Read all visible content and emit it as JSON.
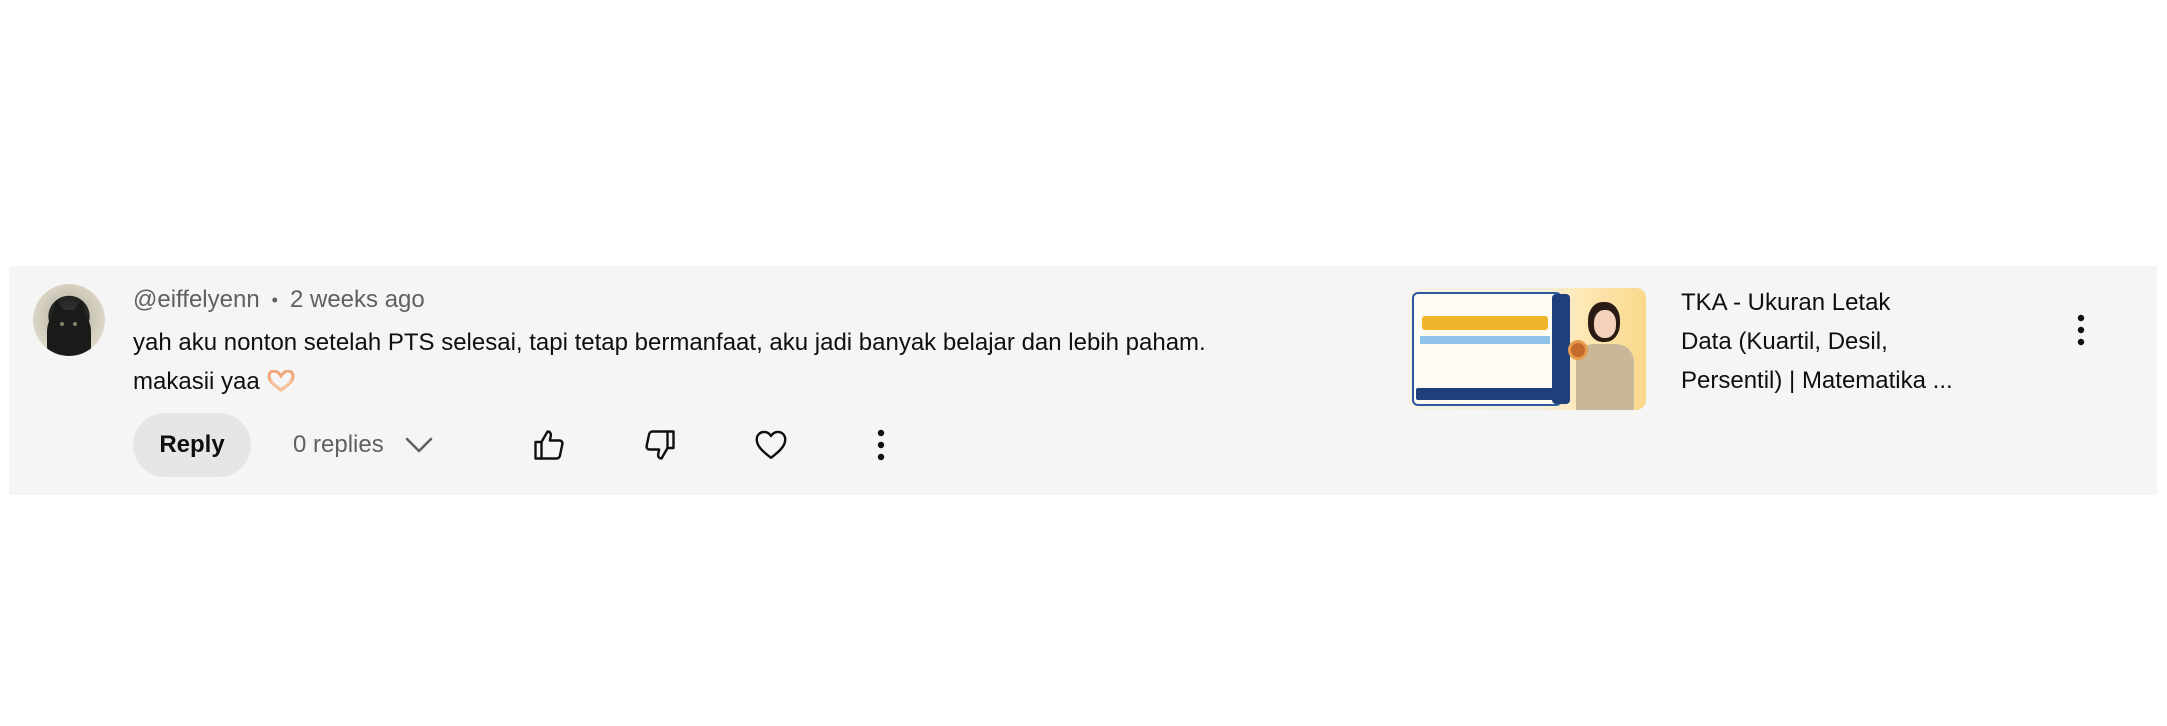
{
  "comment": {
    "author_handle": "@eiffelyenn",
    "separator": "•",
    "timestamp": "2 weeks ago",
    "text_line_1": "yah aku nonton setelah PTS selesai, tapi tetap bermanfaat, aku jadi banyak belajar dan lebih paham.",
    "text_line_2": "makasii yaa",
    "emoji": "heart-hands-emoji"
  },
  "actions": {
    "reply_label": "Reply",
    "replies_label": "0 replies",
    "icons": [
      "chevron-down-icon",
      "thumbs-up-icon",
      "thumbs-down-icon",
      "heart-icon",
      "more-vertical-icon"
    ]
  },
  "video": {
    "title_line_1": "TKA - Ukuran Letak",
    "title_line_2": "Data (Kuartil, Desil,",
    "title_line_3": "Persentil) | Matematika ..."
  },
  "colors": {
    "card_background": "#f5f5f5",
    "primary_text": "#0f0f0f",
    "secondary_text": "#606060",
    "reply_button_bg": "#e6e6e6"
  }
}
